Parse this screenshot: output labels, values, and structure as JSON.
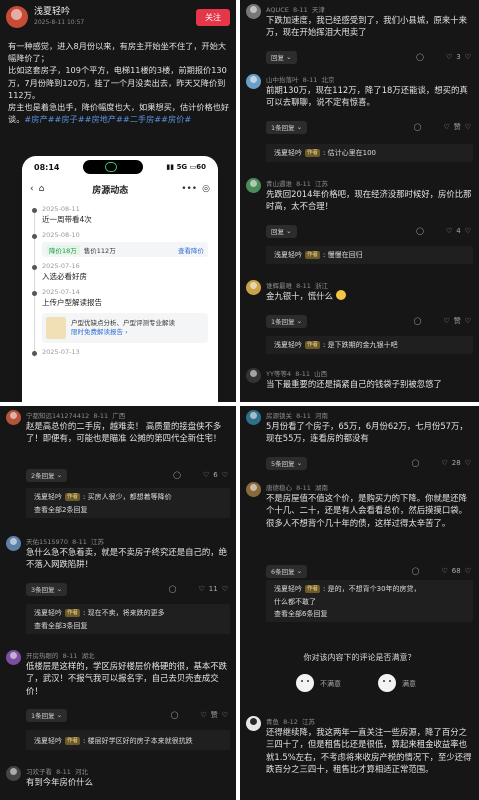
{
  "post": {
    "author": "浅夏轻吟",
    "time": "2025-8-11 10:57",
    "follow_label": "关注",
    "paragraphs": [
      "有一种感觉，进入8月份以来，有房主开始坐不住了，开始大幅降价了；",
      "比如这套房子，109个平方，电梯11楼的3楼，前期报价130万，7月份降到120万，挂了一个月没卖出去，昨天又降价到112万。",
      "房主也是着急出手，降价幅度也大，如果想买，估计价格也好谈。"
    ],
    "tags": "#房产##房子##房地产##二手房##房价#",
    "phone": {
      "time": "08:14",
      "signal": "5G",
      "battery": "60",
      "title": "房源动态",
      "events": [
        {
          "date": "2025-08-11",
          "text": "近一周带看4次"
        },
        {
          "date": "2025-08-10",
          "chip": {
            "down": "降价18万",
            "price": "售价112万",
            "link": "查看降价"
          }
        },
        {
          "date": "2025-07-16",
          "text": "入选必看好房"
        },
        {
          "date": "2025-07-14",
          "text": "上传户型解读报告",
          "card": {
            "t1": "户型优缺点分析、户型评测专业解读",
            "t2": "限时免费解读报告 ›"
          }
        },
        {
          "date": "2025-07-13"
        }
      ]
    }
  },
  "panel_tr": {
    "comments": [
      {
        "user": "AQUCE",
        "date": "8-11",
        "loc": "天津",
        "text": "下跌加速度，我已经感受到了，我们小县城，原来十来万，现在开始挥泪大甩卖了",
        "reply_btn": "回复",
        "likes": "3"
      },
      {
        "user": "山中抬落叶",
        "date": "8-11",
        "loc": "北京",
        "text": "前期130万，现在112万，降了18万还能谈，想买的真可以去聊聊，说不定有惊喜。",
        "reply_btn": "1条回复",
        "likes": "赞"
      },
      {
        "user": "青山遇谁",
        "date": "8-11",
        "loc": "江苏",
        "text": "先跌回2014年价格吧，现在经济没那时候好，房价比那时高，太不合理！",
        "reply_btn": "回复",
        "likes": "4"
      },
      {
        "user": "谁辉最难",
        "date": "8-11",
        "loc": "浙江",
        "text": "金九银十，慌什么",
        "reply_btn": "1条回复",
        "likes": "赞"
      },
      {
        "user": "YY等等4",
        "date": "8-11",
        "loc": "山西",
        "text": "当下最重要的还是搞紧自己的钱袋子别被忽悠了"
      }
    ],
    "replies": [
      {
        "name": "浅夏轻吟",
        "badge": "作者",
        "text": "估计心里在100"
      },
      {
        "name": "浅夏轻吟",
        "badge": "作者",
        "text": "慢慢在回归"
      },
      {
        "name": "浅夏轻吟",
        "badge": "作者",
        "text": "是下跌期的金九银十吧"
      }
    ]
  },
  "panel_bl": {
    "comments": [
      {
        "user": "宁都知远141274412",
        "date": "8-11",
        "loc": "广西",
        "text": "赵是高总价的二手房，越难卖！ 高质量的接盘侠不多了！即便有，可能也是瞄准 公摊的第四代全新住宅！",
        "reply_btn": "2条回复",
        "likes": "6"
      },
      {
        "user": "天佑1515970",
        "date": "8-11",
        "loc": "江苏",
        "text": "急什么急不急着卖，就是不卖房子终究还是自己的，绝不落入网跌陷阱！",
        "reply_btn": "3条回复",
        "likes": "11"
      },
      {
        "user": "开房热眼的",
        "date": "8-11",
        "loc": "湖北",
        "text": "低楼层是这样的，学区房好楼层价格硬的很，基本不跌了，武汉！不报气我可以报名字，自己去贝壳查成交价！",
        "reply_btn": "1条回复",
        "likes": "赞"
      },
      {
        "user": "习欢子看",
        "date": "8-11",
        "loc": "河北",
        "text": "有到今年房价什么"
      }
    ],
    "replies": [
      {
        "name": "浅夏轻吟",
        "badge": "作者",
        "text": "买房人很少，都想着等降价",
        "more": "查看全部2条回复"
      },
      {
        "name": "浅夏轻吟",
        "badge": "作者",
        "text": "现在不卖，将来跌的更多",
        "more": "查看全部3条回复"
      },
      {
        "name": "浅夏轻吟",
        "badge": "作者",
        "text": "楼层好学区好的房子本来就很抗跌"
      }
    ]
  },
  "panel_br": {
    "comments": [
      {
        "user": "房源锁关",
        "date": "8-11",
        "loc": "河南",
        "text": "5月份看了个房子，65万，6月份62万，七月份57万，现在55万，连看房的都没有",
        "reply_btn": "5条回复",
        "likes": "28"
      },
      {
        "user": "唐德稳心",
        "date": "8-11",
        "loc": "湖南",
        "text": "不是房屋值不值这个价，是购买力的下降。你就是还降个十几、二十，还是有人会看看总价，然后摸摸口袋。很多人不想背个几十年的债，这样过得太辛苦了。",
        "reply_btn": "6条回复",
        "likes": "68"
      },
      {
        "user": "青鱼",
        "date": "8-12",
        "loc": "江苏",
        "text": "还得继续降，我这两年一直关注一些房源，降了百分之三四十了，但是租售比还是很低，算起来租金收益率也就1.5%左右，不考虑将来收房产税的情况下，至少还得跌百分之三四十，租售比才算相适正常范围。"
      }
    ],
    "reply": {
      "name": "浅夏轻吟",
      "badge": "作者",
      "line1": "是的，不想背个30年的房贷，",
      "line2": "什么都不敢了",
      "more": "查看全部6条回复"
    },
    "satisfaction": {
      "question": "你对该内容下的评论是否满意？",
      "no": "不满意",
      "yes": "满意"
    }
  },
  "colors": {
    "accent": "#e5364a",
    "link": "#5a8fd8",
    "author_badge": "#f3d78a"
  }
}
